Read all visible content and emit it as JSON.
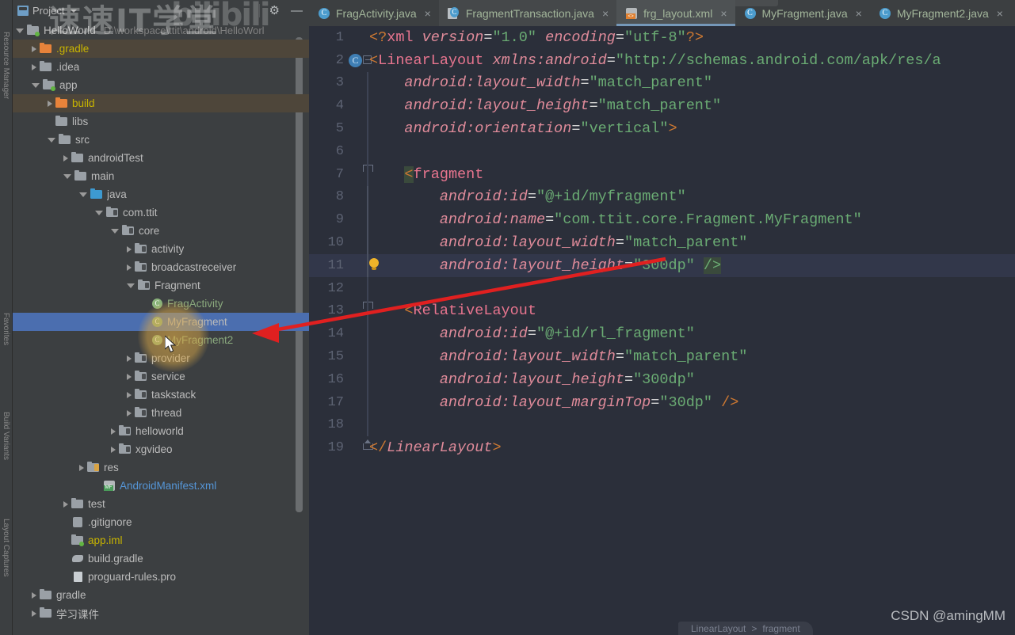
{
  "window": {
    "watermark_cn": "速速IT学堂",
    "watermark_bili": "bilibili",
    "watermark_csdn": "CSDN @amingMM"
  },
  "project_panel": {
    "title": "Project",
    "icon": "project-icon",
    "gear_icon": "gear-icon",
    "minimize_icon": "minimize-icon",
    "root": {
      "label": "HelloWorld",
      "path": "D:\\workspace\\ttit\\android\\HelloWorl"
    },
    "items": [
      {
        "label": ".gradle",
        "indent": 1,
        "arrow": "right",
        "icon": "folder-orange",
        "color": "yellow",
        "state": "hover"
      },
      {
        "label": ".idea",
        "indent": 1,
        "arrow": "right",
        "icon": "folder-grey",
        "color": "grey",
        "state": ""
      },
      {
        "label": "app",
        "indent": 1,
        "arrow": "down",
        "icon": "folder-module",
        "color": "grey",
        "state": ""
      },
      {
        "label": "build",
        "indent": 2,
        "arrow": "right",
        "icon": "folder-orange",
        "color": "yellow",
        "state": "hover"
      },
      {
        "label": "libs",
        "indent": 2,
        "arrow": "none",
        "icon": "folder-grey",
        "color": "grey",
        "state": ""
      },
      {
        "label": "src",
        "indent": 2,
        "arrow": "down",
        "icon": "folder-grey",
        "color": "grey",
        "state": ""
      },
      {
        "label": "androidTest",
        "indent": 3,
        "arrow": "right",
        "icon": "folder-grey",
        "color": "grey",
        "state": ""
      },
      {
        "label": "main",
        "indent": 3,
        "arrow": "down",
        "icon": "folder-grey",
        "color": "grey",
        "state": ""
      },
      {
        "label": "java",
        "indent": 4,
        "arrow": "down",
        "icon": "folder-blue",
        "color": "grey",
        "state": ""
      },
      {
        "label": "com.ttit",
        "indent": 5,
        "arrow": "down",
        "icon": "folder-package",
        "color": "grey",
        "state": ""
      },
      {
        "label": "core",
        "indent": 6,
        "arrow": "down",
        "icon": "folder-package",
        "color": "grey",
        "state": ""
      },
      {
        "label": "activity",
        "indent": 7,
        "arrow": "right",
        "icon": "folder-package",
        "color": "grey",
        "state": ""
      },
      {
        "label": "broadcastreceiver",
        "indent": 7,
        "arrow": "right",
        "icon": "folder-package",
        "color": "grey",
        "state": ""
      },
      {
        "label": "Fragment",
        "indent": 7,
        "arrow": "down",
        "icon": "folder-package",
        "color": "grey",
        "state": ""
      },
      {
        "label": "FragActivity",
        "indent": 8,
        "arrow": "none",
        "icon": "class-green",
        "color": "green",
        "state": ""
      },
      {
        "label": "MyFragment",
        "indent": 8,
        "arrow": "none",
        "icon": "class-green",
        "color": "grey",
        "state": "selected"
      },
      {
        "label": "MyFragment2",
        "indent": 8,
        "arrow": "none",
        "icon": "class-green",
        "color": "green",
        "state": ""
      },
      {
        "label": "provider",
        "indent": 7,
        "arrow": "right",
        "icon": "folder-package",
        "color": "grey",
        "state": ""
      },
      {
        "label": "service",
        "indent": 7,
        "arrow": "right",
        "icon": "folder-package",
        "color": "grey",
        "state": ""
      },
      {
        "label": "taskstack",
        "indent": 7,
        "arrow": "right",
        "icon": "folder-package",
        "color": "grey",
        "state": ""
      },
      {
        "label": "thread",
        "indent": 7,
        "arrow": "right",
        "icon": "folder-package",
        "color": "grey",
        "state": ""
      },
      {
        "label": "helloworld",
        "indent": 6,
        "arrow": "right",
        "icon": "folder-package",
        "color": "grey",
        "state": ""
      },
      {
        "label": "xgvideo",
        "indent": 6,
        "arrow": "right",
        "icon": "folder-package",
        "color": "grey",
        "state": ""
      },
      {
        "label": "res",
        "indent": 4,
        "arrow": "right",
        "icon": "folder-res",
        "color": "grey",
        "state": ""
      },
      {
        "label": "AndroidManifest.xml",
        "indent": 5,
        "arrow": "none",
        "icon": "manifest-file",
        "color": "blue",
        "state": ""
      },
      {
        "label": "test",
        "indent": 3,
        "arrow": "right",
        "icon": "folder-grey",
        "color": "grey",
        "state": ""
      },
      {
        "label": ".gitignore",
        "indent": 3,
        "arrow": "none",
        "icon": "gitignore-file",
        "color": "grey",
        "state": ""
      },
      {
        "label": "app.iml",
        "indent": 3,
        "arrow": "none",
        "icon": "iml-file",
        "color": "yellow",
        "state": ""
      },
      {
        "label": "build.gradle",
        "indent": 3,
        "arrow": "none",
        "icon": "gradle-file",
        "color": "grey",
        "state": ""
      },
      {
        "label": "proguard-rules.pro",
        "indent": 3,
        "arrow": "none",
        "icon": "text-file",
        "color": "grey",
        "state": ""
      },
      {
        "label": "gradle",
        "indent": 1,
        "arrow": "right",
        "icon": "folder-grey",
        "color": "grey",
        "state": ""
      },
      {
        "label": "学习课件",
        "indent": 1,
        "arrow": "right",
        "icon": "folder-grey",
        "color": "grey",
        "state": ""
      }
    ]
  },
  "toolstrip": {
    "items": [
      "Resource Manager",
      "Favorites",
      "Build Variants",
      "Layout Captures"
    ]
  },
  "tabs": [
    {
      "label": "FragActivity.java",
      "icon": "java-class-icon",
      "active": false,
      "close": "×"
    },
    {
      "label": "FragmentTransaction.java",
      "icon": "java-library-icon",
      "active": false,
      "close": "×"
    },
    {
      "label": "frg_layout.xml",
      "icon": "xml-file-icon",
      "active": true,
      "close": "×"
    },
    {
      "label": "MyFragment.java",
      "icon": "java-class-icon",
      "active": false,
      "close": "×"
    },
    {
      "label": "MyFragment2.java",
      "icon": "java-class-icon",
      "active": false,
      "close": "×"
    }
  ],
  "editor": {
    "breadcrumb": [
      "LinearLayout",
      "fragment"
    ],
    "breadcrumb_separator": ">",
    "lines": [
      {
        "n": "1",
        "text": "<?xml version=\"1.0\" encoding=\"utf-8\"?>"
      },
      {
        "n": "2",
        "text": "<LinearLayout xmlns:android=\"http://schemas.android.com/apk/res/a"
      },
      {
        "n": "3",
        "text": "    android:layout_width=\"match_parent\""
      },
      {
        "n": "4",
        "text": "    android:layout_height=\"match_parent\""
      },
      {
        "n": "5",
        "text": "    android:orientation=\"vertical\">"
      },
      {
        "n": "6",
        "text": ""
      },
      {
        "n": "7",
        "text": "    <fragment"
      },
      {
        "n": "8",
        "text": "        android:id=\"@+id/myfragment\""
      },
      {
        "n": "9",
        "text": "        android:name=\"com.ttit.core.Fragment.MyFragment\""
      },
      {
        "n": "10",
        "text": "        android:layout_width=\"match_parent\""
      },
      {
        "n": "11",
        "text": "        android:layout_height=\"300dp\" />"
      },
      {
        "n": "12",
        "text": ""
      },
      {
        "n": "13",
        "text": "    <RelativeLayout"
      },
      {
        "n": "14",
        "text": "        android:id=\"@+id/rl_fragment\""
      },
      {
        "n": "15",
        "text": "        android:layout_width=\"match_parent\""
      },
      {
        "n": "16",
        "text": "        android:layout_height=\"300dp\""
      },
      {
        "n": "17",
        "text": "        android:layout_marginTop=\"30dp\" />"
      },
      {
        "n": "18",
        "text": ""
      },
      {
        "n": "19",
        "text": "</LinearLayout>"
      }
    ],
    "gutter_markers": {
      "line2": "class-marker-icon",
      "line11": "intention-bulb-icon"
    }
  },
  "annotation": {
    "arrow_color": "#e02020",
    "highlight_color": "#dba846",
    "cursor_icon": "mouse-pointer-icon"
  },
  "colors": {
    "panel_bg": "#3c3f41",
    "editor_bg": "#2b2f3a",
    "selection": "#4b6eaf",
    "tab_active": "#4e5254",
    "accent": "#7597b8"
  }
}
